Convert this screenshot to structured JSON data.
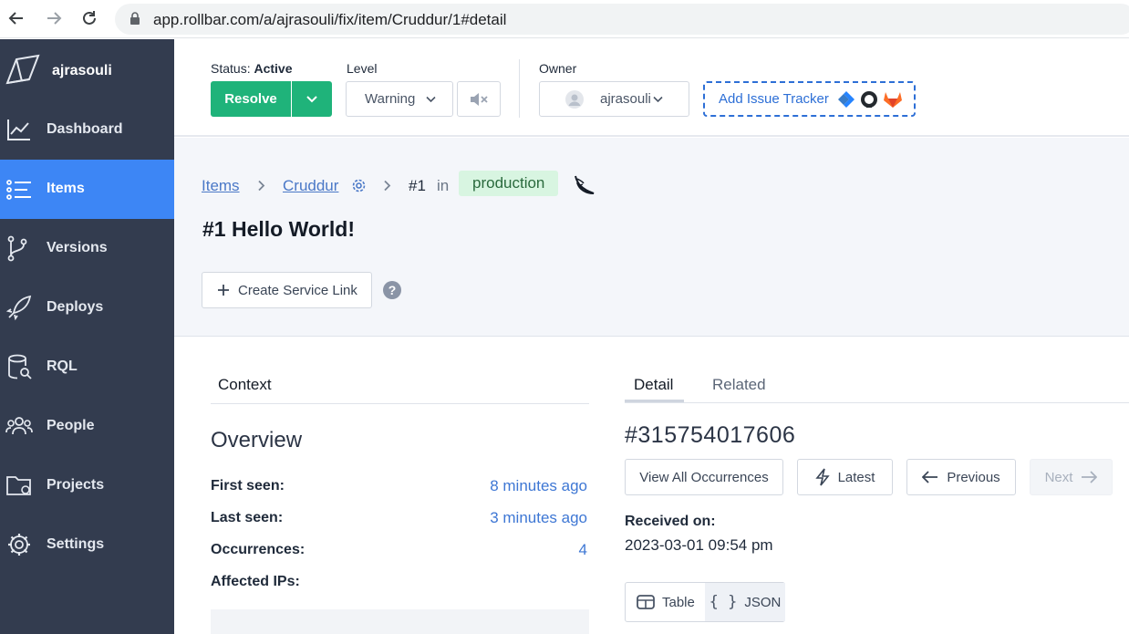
{
  "browser": {
    "url": "app.rollbar.com/a/ajrasouli/fix/item/Cruddur/1#detail"
  },
  "sidebar": {
    "account_name": "ajrasouli",
    "items": [
      {
        "label": "Dashboard",
        "icon": "chart-line-icon"
      },
      {
        "label": "Items",
        "icon": "list-icon"
      },
      {
        "label": "Versions",
        "icon": "git-branch-icon"
      },
      {
        "label": "Deploys",
        "icon": "rocket-icon"
      },
      {
        "label": "RQL",
        "icon": "database-search-icon"
      },
      {
        "label": "People",
        "icon": "people-icon"
      },
      {
        "label": "Projects",
        "icon": "folder-icon"
      },
      {
        "label": "Settings",
        "icon": "gear-icon"
      }
    ],
    "active_item": "Items"
  },
  "status_bar": {
    "status_label": "Status:",
    "status_value": "Active",
    "resolve_label": "Resolve",
    "level_label": "Level",
    "level_value": "Warning",
    "owner_label": "Owner",
    "owner_value": "ajrasouli",
    "tracker_label": "Add Issue Tracker"
  },
  "breadcrumb": {
    "items_link": "Items",
    "project_link": "Cruddur",
    "item_number": "#1",
    "in_text": "in",
    "environment": "production"
  },
  "item": {
    "title": "#1 Hello World!",
    "service_link_label": "Create Service Link",
    "help": "?"
  },
  "left_panel": {
    "tab": "Context",
    "overview_title": "Overview",
    "rows": [
      {
        "label": "First seen:",
        "value": "8 minutes ago"
      },
      {
        "label": "Last seen:",
        "value": "3 minutes ago"
      },
      {
        "label": "Occurrences:",
        "value": "4"
      },
      {
        "label": "Affected IPs:",
        "value": ""
      }
    ]
  },
  "right_panel": {
    "tabs": [
      "Detail",
      "Related"
    ],
    "active_tab": "Detail",
    "occurrence_id": "#315754017606",
    "buttons": {
      "view_all": "View All Occurrences",
      "latest": "Latest",
      "previous": "Previous",
      "next": "Next"
    },
    "received_label": "Received on:",
    "received_value": "2023-03-01 09:54 pm",
    "view_toggle": {
      "table": "Table",
      "json": "JSON"
    }
  },
  "colors": {
    "sidebar_bg": "#333c4f",
    "active_nav": "#3d86f5",
    "resolve_green": "#1fb37a",
    "link_blue": "#3e77d4",
    "env_badge_bg": "#d8f5e1"
  }
}
